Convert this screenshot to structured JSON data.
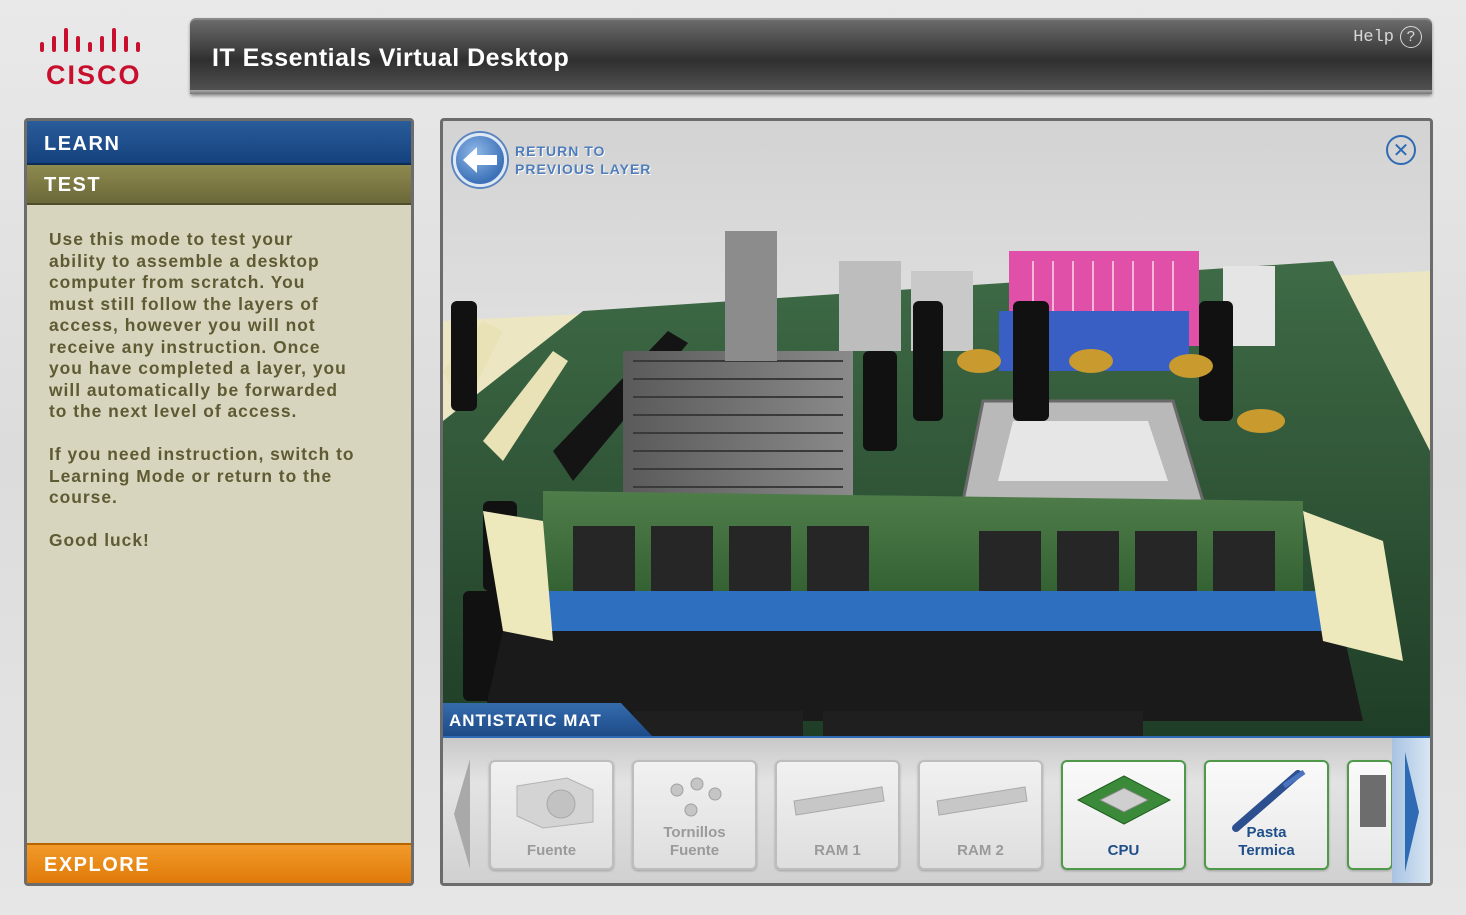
{
  "header": {
    "logo_text": "CISCO",
    "app_title": "IT Essentials Virtual Desktop",
    "help_label": "Help",
    "help_icon": "question-circle-icon"
  },
  "left_panel": {
    "tab_learn": "LEARN",
    "tab_test": "TEST",
    "paragraph_1": "Use this mode to test your\nability to assemble a desktop\ncomputer from scratch. You\nmust still follow the layers of\naccess, however you will not\nreceive any instruction. Once\nyou have completed a layer, you\nwill automatically be forwarded\nto the next level of access.",
    "paragraph_2": "If you need instruction, switch to\nLearning Mode or return to the\ncourse.",
    "paragraph_3": "Good luck!",
    "tab_explore": "EXPLORE"
  },
  "viewport": {
    "return_line_1": "RETURN TO",
    "return_line_2": "PREVIOUS LAYER",
    "mat_label": "ANTISTATIC MAT"
  },
  "tray": {
    "parts": [
      {
        "label": "Fuente",
        "icon": "power-supply-icon",
        "state": "disabled"
      },
      {
        "label": "Tornillos\nFuente",
        "icon": "screws-icon",
        "state": "disabled"
      },
      {
        "label": "RAM 1",
        "icon": "ram-module-icon",
        "state": "disabled"
      },
      {
        "label": "RAM 2",
        "icon": "ram-module-icon",
        "state": "disabled"
      },
      {
        "label": "CPU",
        "icon": "cpu-chip-icon",
        "state": "active"
      },
      {
        "label": "Pasta\nTermica",
        "icon": "thermal-paste-syringe-icon",
        "state": "active"
      }
    ]
  },
  "colors": {
    "learn_tab": "#14427e",
    "test_tab": "#6b6839",
    "explore_tab": "#e07a08",
    "panel_bg": "#d7d5bd",
    "accent_blue": "#2f6bb4",
    "cisco_red": "#c8102e"
  }
}
